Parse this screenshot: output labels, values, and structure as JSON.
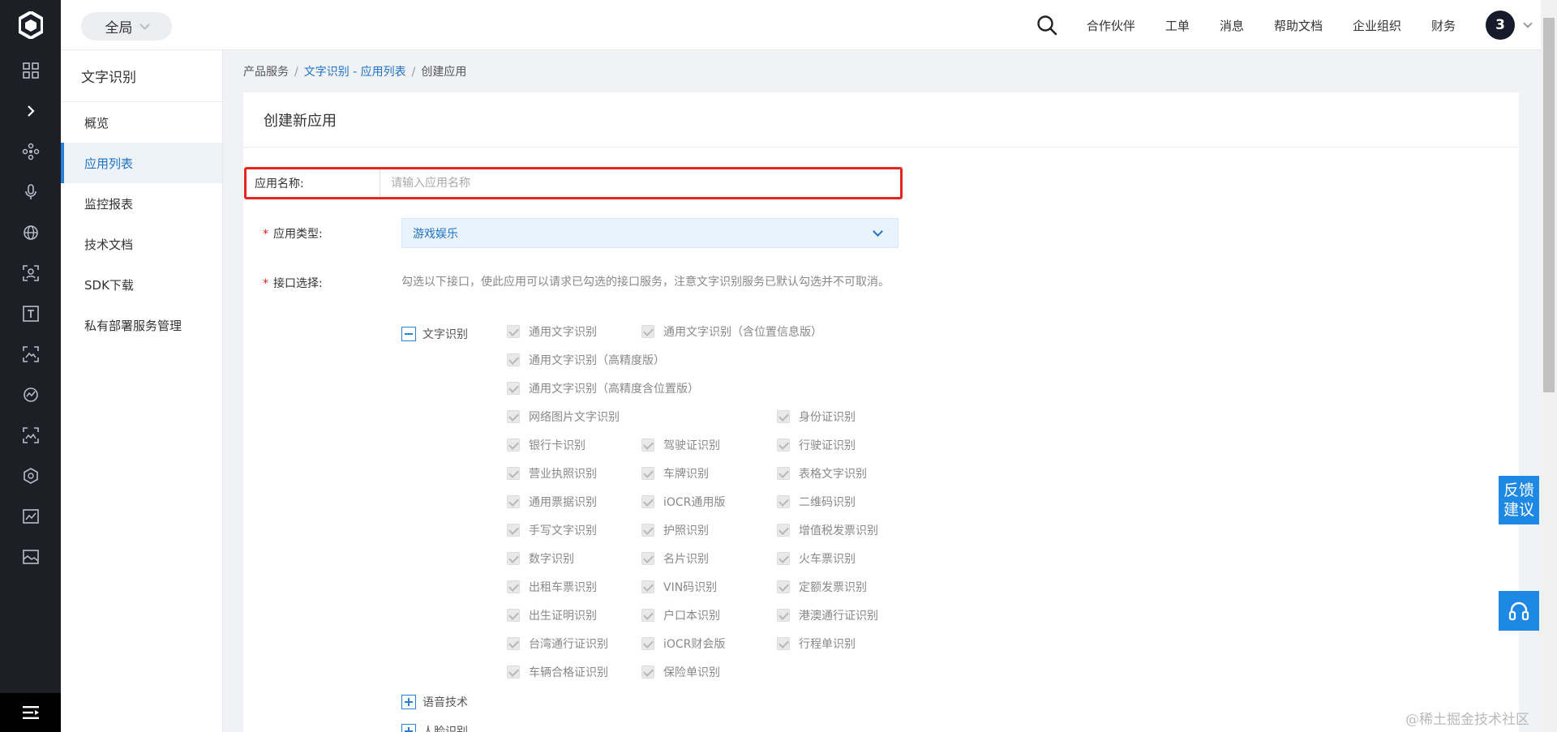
{
  "rail": {
    "icons": [
      "grid-icon",
      "chevron-right-icon",
      "nodes-icon",
      "microphone-icon",
      "globe-icon",
      "face-scan-icon",
      "text-t-icon",
      "image-scan-icon",
      "chart-icon",
      "scan-landscape-icon",
      "cube-icon",
      "monitor-chart-icon",
      "picture-icon"
    ],
    "bottom_icon": "menu-icon"
  },
  "topbar": {
    "scope": "全局",
    "nav": [
      "合作伙伴",
      "工单",
      "消息",
      "帮助文档",
      "企业组织",
      "财务"
    ],
    "avatar": "3"
  },
  "sidebar": {
    "title": "文字识别",
    "items": [
      {
        "label": "概览",
        "active": false
      },
      {
        "label": "应用列表",
        "active": true
      },
      {
        "label": "监控报表",
        "active": false
      },
      {
        "label": "技术文档",
        "active": false
      },
      {
        "label": "SDK下载",
        "active": false
      },
      {
        "label": "私有部署服务管理",
        "active": false
      }
    ]
  },
  "breadcrumb": {
    "root": "产品服务",
    "link": "文字识别 - 应用列表",
    "current": "创建应用",
    "sep": "/"
  },
  "form": {
    "title": "创建新应用",
    "name_label": "应用名称:",
    "name_placeholder": "请输入应用名称",
    "name_value": "",
    "type_label": "应用类型:",
    "type_value": "游戏娱乐",
    "api_label": "接口选择:",
    "required_mark": "*",
    "hint": "勾选以下接口，使此应用可以请求已勾选的接口服务，注意文字识别服务已默认勾选并不可取消。",
    "groups": [
      {
        "label": "文字识别",
        "expanded": true
      },
      {
        "label": "语音技术",
        "expanded": false
      },
      {
        "label": "人脸识别",
        "expanded": false
      }
    ],
    "apis": [
      "通用文字识别",
      "通用文字识别（含位置信息版）",
      "通用文字识别（高精度版）",
      "通用文字识别（高精度含位置版）",
      "网络图片文字识别",
      "身份证识别",
      "银行卡识别",
      "驾驶证识别",
      "行驶证识别",
      "营业执照识别",
      "车牌识别",
      "表格文字识别",
      "通用票据识别",
      "iOCR通用版",
      "二维码识别",
      "手写文字识别",
      "护照识别",
      "增值税发票识别",
      "数字识别",
      "名片识别",
      "火车票识别",
      "出租车票识别",
      "VIN码识别",
      "定额发票识别",
      "出生证明识别",
      "户口本识别",
      "港澳通行证识别",
      "台湾通行证识别",
      "iOCR财会版",
      "行程单识别",
      "车辆合格证识别",
      "保险单识别"
    ]
  },
  "floating": {
    "feedback_line1": "反馈",
    "feedback_line2": "建议",
    "support_icon": "headset-icon",
    "watermark": "@稀土掘金技术社区"
  },
  "colors": {
    "rail_bg": "#1c1f26",
    "accent": "#1f72c6",
    "highlight_border": "#e5261f",
    "feedback_bg": "#1e88e5"
  }
}
